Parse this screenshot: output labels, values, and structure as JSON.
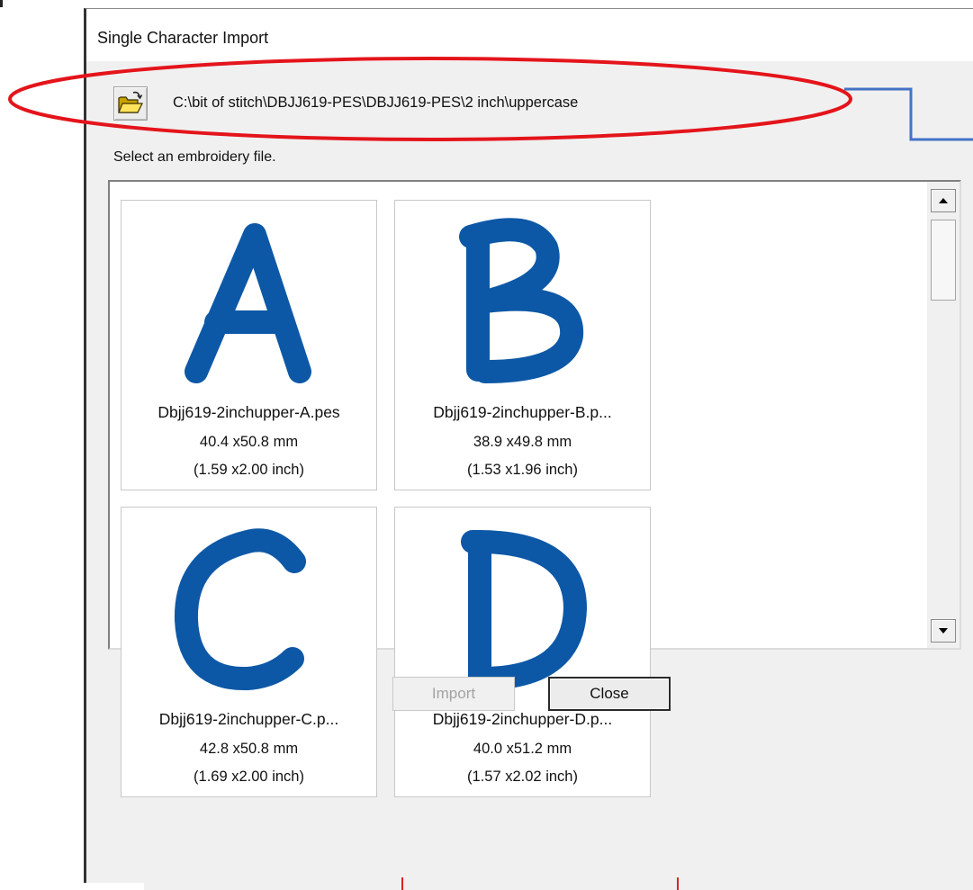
{
  "window": {
    "title": "Single Character Import"
  },
  "path_bar": {
    "folder_icon": "open-folder-icon",
    "path": "C:\\bit of stitch\\DBJJ619-PES\\DBJJ619-PES\\2 inch\\uppercase"
  },
  "prompt": "Select an embroidery file.",
  "files": [
    {
      "letter": "A",
      "name": "Dbjj619-2inchupper-A.pes",
      "size_mm": "40.4 x50.8 mm",
      "size_inch": "(1.59 x2.00 inch)"
    },
    {
      "letter": "B",
      "name": "Dbjj619-2inchupper-B.p...",
      "size_mm": "38.9 x49.8 mm",
      "size_inch": "(1.53 x1.96 inch)"
    },
    {
      "letter": "C",
      "name": "Dbjj619-2inchupper-C.p...",
      "size_mm": "42.8 x50.8 mm",
      "size_inch": "(1.69 x2.00 inch)"
    },
    {
      "letter": "D",
      "name": "Dbjj619-2inchupper-D.p...",
      "size_mm": "40.0 x51.2 mm",
      "size_inch": "(1.57 x2.02 inch)"
    }
  ],
  "buttons": {
    "import": "Import",
    "close": "Close",
    "import_enabled": false
  },
  "colors": {
    "thread": "#0d58a6",
    "annotation_ellipse": "#e4141b",
    "annotation_connector": "#4472c4"
  }
}
